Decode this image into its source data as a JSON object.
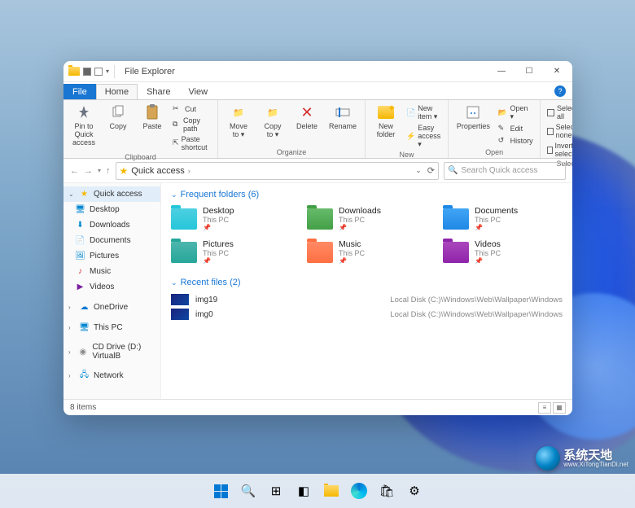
{
  "window": {
    "title": "File Explorer"
  },
  "tabs": {
    "file": "File",
    "home": "Home",
    "share": "Share",
    "view": "View"
  },
  "ribbon": {
    "clipboard": {
      "label": "Clipboard",
      "pin": "Pin to Quick\naccess",
      "copy": "Copy",
      "paste": "Paste",
      "cut": "Cut",
      "copypath": "Copy path",
      "shortcut": "Paste shortcut"
    },
    "organize": {
      "label": "Organize",
      "moveto": "Move\nto ▾",
      "copyto": "Copy\nto ▾",
      "delete": "Delete",
      "rename": "Rename"
    },
    "new": {
      "label": "New",
      "newfolder": "New\nfolder",
      "newitem": "New item ▾",
      "easyaccess": "Easy access ▾"
    },
    "open": {
      "label": "Open",
      "properties": "Properties",
      "open": "Open ▾",
      "edit": "Edit",
      "history": "History"
    },
    "select": {
      "label": "Select",
      "all": "Select all",
      "none": "Select none",
      "invert": "Invert selection"
    }
  },
  "address": {
    "location": "Quick access",
    "search_placeholder": "Search Quick access"
  },
  "nav": {
    "quickaccess": "Quick access",
    "desktop": "Desktop",
    "downloads": "Downloads",
    "documents": "Documents",
    "pictures": "Pictures",
    "music": "Music",
    "videos": "Videos",
    "onedrive": "OneDrive",
    "thispc": "This PC",
    "cddrive": "CD Drive (D:) VirtualB",
    "network": "Network"
  },
  "sections": {
    "frequent": "Frequent folders (6)",
    "recent": "Recent files (2)"
  },
  "folders": [
    {
      "name": "Desktop",
      "sub": "This PC"
    },
    {
      "name": "Downloads",
      "sub": "This PC"
    },
    {
      "name": "Documents",
      "sub": "This PC"
    },
    {
      "name": "Pictures",
      "sub": "This PC"
    },
    {
      "name": "Music",
      "sub": "This PC"
    },
    {
      "name": "Videos",
      "sub": "This PC"
    }
  ],
  "files": [
    {
      "name": "img19",
      "path": "Local Disk (C:)\\Windows\\Web\\Wallpaper\\Windows"
    },
    {
      "name": "img0",
      "path": "Local Disk (C:)\\Windows\\Web\\Wallpaper\\Windows"
    }
  ],
  "status": {
    "items": "8 items"
  },
  "watermark": {
    "cn": "系统天地",
    "en": "www.XiTongTianDi.net"
  }
}
